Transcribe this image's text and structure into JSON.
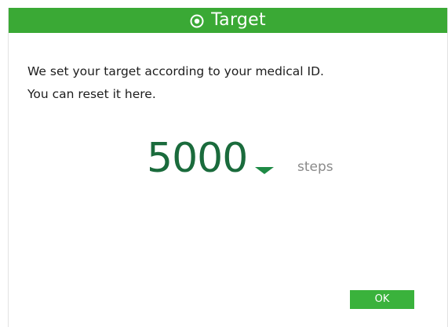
{
  "dialog": {
    "title": "Target",
    "title_icon": "target-icon",
    "message_line1": "We set your target according to your medical ID.",
    "message_line2": "You can reset it here.",
    "target_value": "5000",
    "dropdown_icon": "chevron-down-icon",
    "unit": "steps",
    "ok_label": "OK"
  },
  "colors": {
    "titlebar": "#3aa935",
    "value": "#1a6b3c",
    "button": "#3ab23c",
    "unit": "#8a8a8a"
  }
}
